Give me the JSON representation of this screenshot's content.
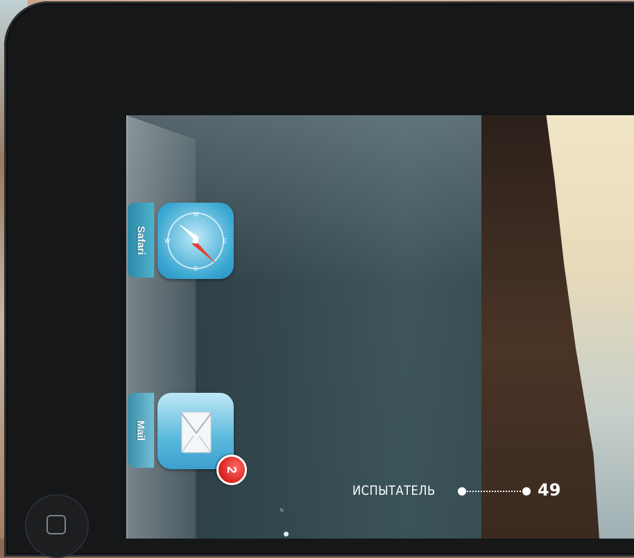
{
  "switcher": {
    "apps": [
      {
        "label": "Safari",
        "icon": "safari-compass-icon"
      },
      {
        "label": "Mail",
        "icon": "mail-envelope-icon",
        "badge": "2"
      }
    ]
  },
  "dock": {
    "search_glyph": "⌕",
    "home_icon": "home-square-icon"
  },
  "magazine": {
    "section": "ИСПЫТАТЕЛЬ",
    "page": "49"
  },
  "colors": {
    "bezel": "#151719",
    "badge": "#d8201c",
    "safari": "#3ba8d2",
    "mail": "#5ab9dc"
  }
}
